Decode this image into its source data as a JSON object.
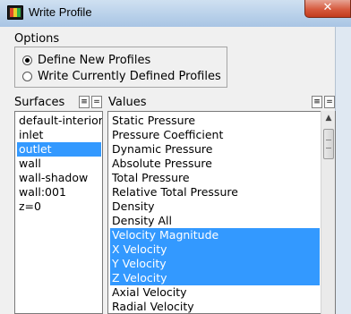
{
  "window": {
    "title": "Write Profile",
    "close_glyph": "✕"
  },
  "options": {
    "label": "Options",
    "items": [
      {
        "label": "Define New Profiles",
        "checked": true
      },
      {
        "label": "Write Currently Defined Profiles",
        "checked": false
      }
    ]
  },
  "surfaces": {
    "label": "Surfaces",
    "btn_all_glyph": "≡",
    "btn_none_glyph": "=",
    "items": [
      {
        "label": "default-interior",
        "selected": false
      },
      {
        "label": "inlet",
        "selected": false
      },
      {
        "label": "outlet",
        "selected": true
      },
      {
        "label": "wall",
        "selected": false
      },
      {
        "label": "wall-shadow",
        "selected": false
      },
      {
        "label": "wall:001",
        "selected": false
      },
      {
        "label": "z=0",
        "selected": false
      }
    ]
  },
  "values": {
    "label": "Values",
    "btn_all_glyph": "≡",
    "btn_none_glyph": "=",
    "items": [
      {
        "label": "Static Pressure",
        "selected": false
      },
      {
        "label": "Pressure Coefficient",
        "selected": false
      },
      {
        "label": "Dynamic Pressure",
        "selected": false
      },
      {
        "label": "Absolute Pressure",
        "selected": false
      },
      {
        "label": "Total Pressure",
        "selected": false
      },
      {
        "label": "Relative Total Pressure",
        "selected": false
      },
      {
        "label": "Density",
        "selected": false
      },
      {
        "label": "Density All",
        "selected": false
      },
      {
        "label": "Velocity Magnitude",
        "selected": true
      },
      {
        "label": "X Velocity",
        "selected": true
      },
      {
        "label": "Y Velocity",
        "selected": true
      },
      {
        "label": "Z Velocity",
        "selected": true
      },
      {
        "label": "Axial Velocity",
        "selected": false
      },
      {
        "label": "Radial Velocity",
        "selected": false
      }
    ],
    "scroll_up_glyph": "▲"
  },
  "colors": {
    "selection": "#3399ff",
    "title_bar": "#b9d1ea",
    "close_button": "#d65a3e"
  }
}
